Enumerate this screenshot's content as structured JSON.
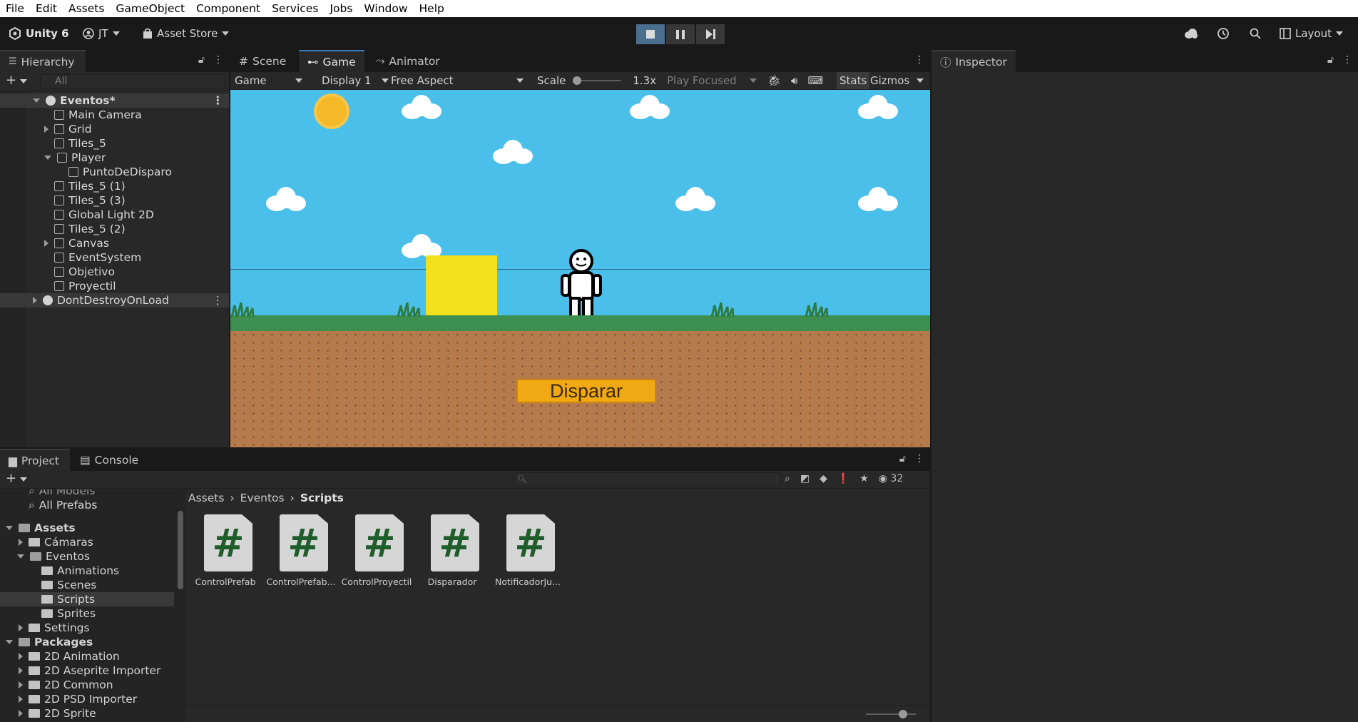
{
  "menubar": [
    "File",
    "Edit",
    "Assets",
    "GameObject",
    "Component",
    "Services",
    "Jobs",
    "Window",
    "Help"
  ],
  "toolbar": {
    "product": "Unity 6",
    "account": "JT",
    "asset_store": "Asset Store",
    "layout": "Layout"
  },
  "hierarchy": {
    "tab": "Hierarchy",
    "search_placeholder": "All",
    "items": [
      {
        "label": "Eventos*",
        "kind": "scene"
      },
      {
        "label": "Main Camera"
      },
      {
        "label": "Grid"
      },
      {
        "label": "Tiles_5"
      },
      {
        "label": "Player"
      },
      {
        "label": "PuntoDeDisparo"
      },
      {
        "label": "Tiles_5 (1)"
      },
      {
        "label": "Tiles_5 (3)"
      },
      {
        "label": "Global Light 2D"
      },
      {
        "label": "Tiles_5 (2)"
      },
      {
        "label": "Canvas"
      },
      {
        "label": "EventSystem"
      },
      {
        "label": "Objetivo"
      },
      {
        "label": "Proyectil"
      },
      {
        "label": "DontDestroyOnLoad",
        "kind": "scene"
      }
    ]
  },
  "game_view": {
    "tabs": [
      "Scene",
      "Game",
      "Animator"
    ],
    "mode": "Game",
    "display": "Display 1",
    "aspect": "Free Aspect",
    "scale_label": "Scale",
    "scale_value": "1.3x",
    "play_mode": "Play Focused",
    "stats": "Stats",
    "gizmos": "Gizmos",
    "fire_button": "Disparar"
  },
  "inspector": {
    "tab": "Inspector"
  },
  "project": {
    "tabs": [
      "Project",
      "Console"
    ],
    "count": "32",
    "breadcrumb": [
      "Assets",
      "Eventos",
      "Scripts"
    ],
    "tree": [
      {
        "label": "All Models"
      },
      {
        "label": "All Prefabs"
      },
      {
        "label": "Assets"
      },
      {
        "label": "Cámaras"
      },
      {
        "label": "Eventos"
      },
      {
        "label": "Animations"
      },
      {
        "label": "Scenes"
      },
      {
        "label": "Scripts"
      },
      {
        "label": "Sprites"
      },
      {
        "label": "Settings"
      },
      {
        "label": "Packages"
      },
      {
        "label": "2D Animation"
      },
      {
        "label": "2D Aseprite Importer"
      },
      {
        "label": "2D Common"
      },
      {
        "label": "2D PSD Importer"
      },
      {
        "label": "2D Sprite"
      }
    ],
    "assets": [
      {
        "label": "ControlPrefab"
      },
      {
        "label": "ControlPrefab..."
      },
      {
        "label": "ControlProyectil"
      },
      {
        "label": "Disparador"
      },
      {
        "label": "NotificadorJu..."
      }
    ],
    "asset_glyph": "#"
  },
  "colors": {
    "accent": "#3a79bb",
    "sky": "#49bfea",
    "button": "#f0a814",
    "target_box": "#f2e01c"
  }
}
